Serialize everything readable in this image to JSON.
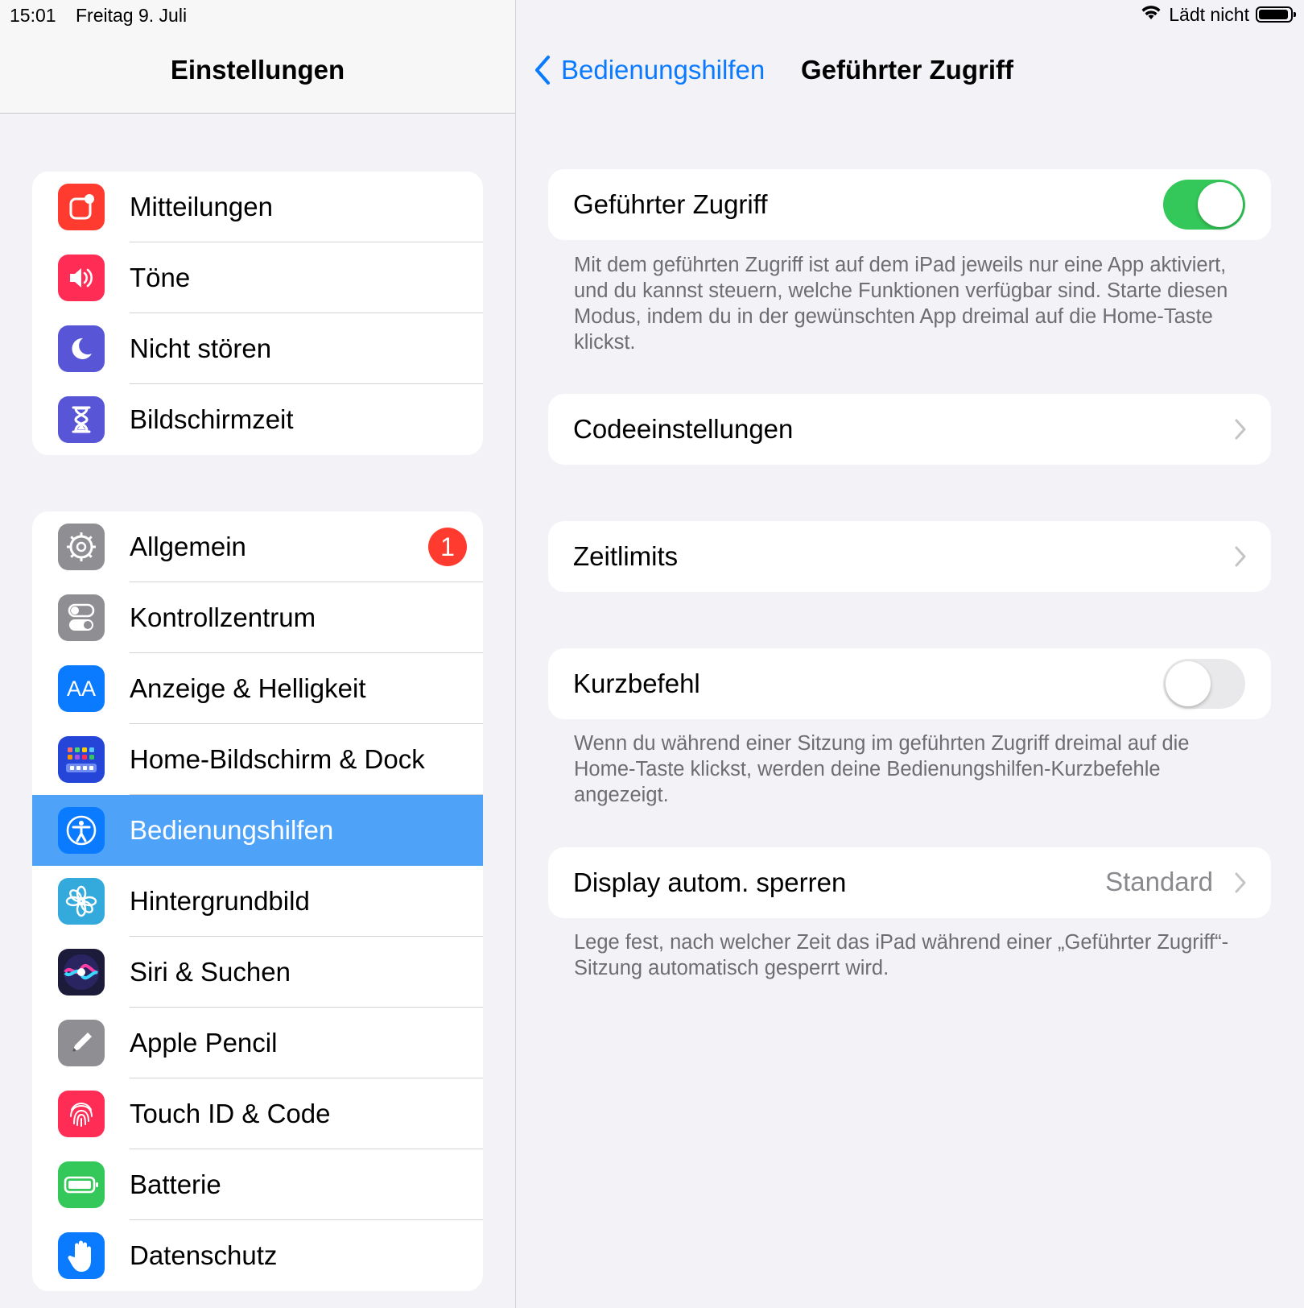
{
  "status": {
    "time": "15:01",
    "date": "Freitag 9. Juli",
    "charging": "Lädt nicht"
  },
  "sidebar": {
    "title": "Einstellungen",
    "group1": [
      {
        "label": "Mitteilungen",
        "icon": "notifications-icon",
        "color": "#ff3b30"
      },
      {
        "label": "Töne",
        "icon": "speaker-icon",
        "color": "#ff2d55"
      },
      {
        "label": "Nicht stören",
        "icon": "moon-icon",
        "color": "#5856d6"
      },
      {
        "label": "Bildschirmzeit",
        "icon": "hourglass-icon",
        "color": "#5856d6"
      }
    ],
    "group2": [
      {
        "label": "Allgemein",
        "icon": "gear-icon",
        "color": "#8e8e93",
        "badge": "1"
      },
      {
        "label": "Kontrollzentrum",
        "icon": "toggles-icon",
        "color": "#8e8e93"
      },
      {
        "label": "Anzeige & Helligkeit",
        "icon": "text-size-icon",
        "color": "#0a7aff"
      },
      {
        "label": "Home-Bildschirm & Dock",
        "icon": "home-grid-icon",
        "color": "#2445d8"
      },
      {
        "label": "Bedienungshilfen",
        "icon": "accessibility-icon",
        "color": "#0a7aff",
        "selected": true
      },
      {
        "label": "Hintergrundbild",
        "icon": "flower-icon",
        "color": "#34aadc"
      },
      {
        "label": "Siri & Suchen",
        "icon": "siri-icon",
        "color": "#1c1c3a"
      },
      {
        "label": "Apple Pencil",
        "icon": "pencil-icon",
        "color": "#8e8e93"
      },
      {
        "label": "Touch ID & Code",
        "icon": "fingerprint-icon",
        "color": "#ff2d55"
      },
      {
        "label": "Batterie",
        "icon": "battery-icon",
        "color": "#34c759"
      },
      {
        "label": "Datenschutz",
        "icon": "hand-icon",
        "color": "#0a7aff"
      }
    ]
  },
  "detail": {
    "back_label": "Bedienungshilfen",
    "title": "Geführter Zugriff",
    "guided_access": {
      "label": "Geführter Zugriff",
      "on": true
    },
    "guided_access_footer": "Mit dem geführten Zugriff ist auf dem iPad jeweils nur eine App aktiviert, und du kannst steuern, welche Funktionen verfügbar sind. Starte diesen Modus, indem du in der gewünschten App dreimal auf die Home-Taste klickst.",
    "code_settings": "Codeeinstellungen",
    "time_limits": "Zeitlimits",
    "shortcut": {
      "label": "Kurzbefehl",
      "on": false
    },
    "shortcut_footer": "Wenn du während einer Sitzung im geführten Zugriff dreimal auf die Home-Taste klickst, werden deine Bedienungshilfen-Kurzbefehle angezeigt.",
    "auto_lock": {
      "label": "Display autom. sperren",
      "value": "Standard"
    },
    "auto_lock_footer": "Lege fest, nach welcher Zeit das iPad während einer „Geführter Zugriff“-Sitzung automatisch gesperrt wird."
  }
}
